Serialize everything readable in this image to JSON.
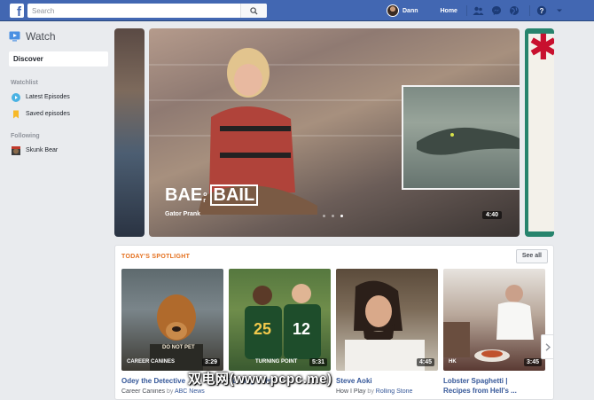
{
  "topbar": {
    "search_placeholder": "Search",
    "user_name": "Dann",
    "home_label": "Home",
    "icons": [
      "friends-icon",
      "messenger-icon",
      "globe-icon",
      "help-icon",
      "caret-icon"
    ]
  },
  "sidebar": {
    "title": "Watch",
    "discover_label": "Discover",
    "watchlist_header": "Watchlist",
    "watchlist": [
      {
        "label": "Latest Episodes",
        "icon": "play-circle-icon"
      },
      {
        "label": "Saved episodes",
        "icon": "bookmark-icon"
      }
    ],
    "following_header": "Following",
    "following": [
      {
        "label": "Skunk Bear",
        "icon": "page-avatar"
      }
    ]
  },
  "hero": {
    "logo_left": "BAE",
    "logo_or_o": "o",
    "logo_or_r": "r",
    "logo_right": "BAIL",
    "caption": "Gator Prank",
    "duration": "4:40",
    "slides": 3,
    "active_slide": 2
  },
  "spotlight": {
    "title": "TODAY'S SPOTLIGHT",
    "see_all": "See all",
    "cards": [
      {
        "title": "Odey the Detective",
        "show": "Career Canines",
        "by": "by",
        "source": "ABC News",
        "duration": "3:29",
        "thumb_label": "CAREER CANINES",
        "thumb_badge": "DO NOT PET"
      },
      {
        "title": "Turning Point",
        "show": "",
        "by": "",
        "source": "",
        "duration": "5:31",
        "thumb_label": "TURNING POINT",
        "thumb_badge": ""
      },
      {
        "title": "Steve Aoki",
        "show": "How I Play",
        "by": "by",
        "source": "Rolling Stone",
        "duration": "4:45",
        "thumb_label": "",
        "thumb_badge": ""
      },
      {
        "title": "Lobster Spaghetti |",
        "title2": "Recipes from Hell's ...",
        "show": "",
        "by": "",
        "source": "",
        "duration": "3:45",
        "thumb_label": "HK",
        "thumb_badge": ""
      }
    ]
  },
  "watermark": "双电网(www.pcpc.me)",
  "colors": {
    "brand": "#4267b2",
    "accent_orange": "#e4701e",
    "link": "#365899"
  }
}
